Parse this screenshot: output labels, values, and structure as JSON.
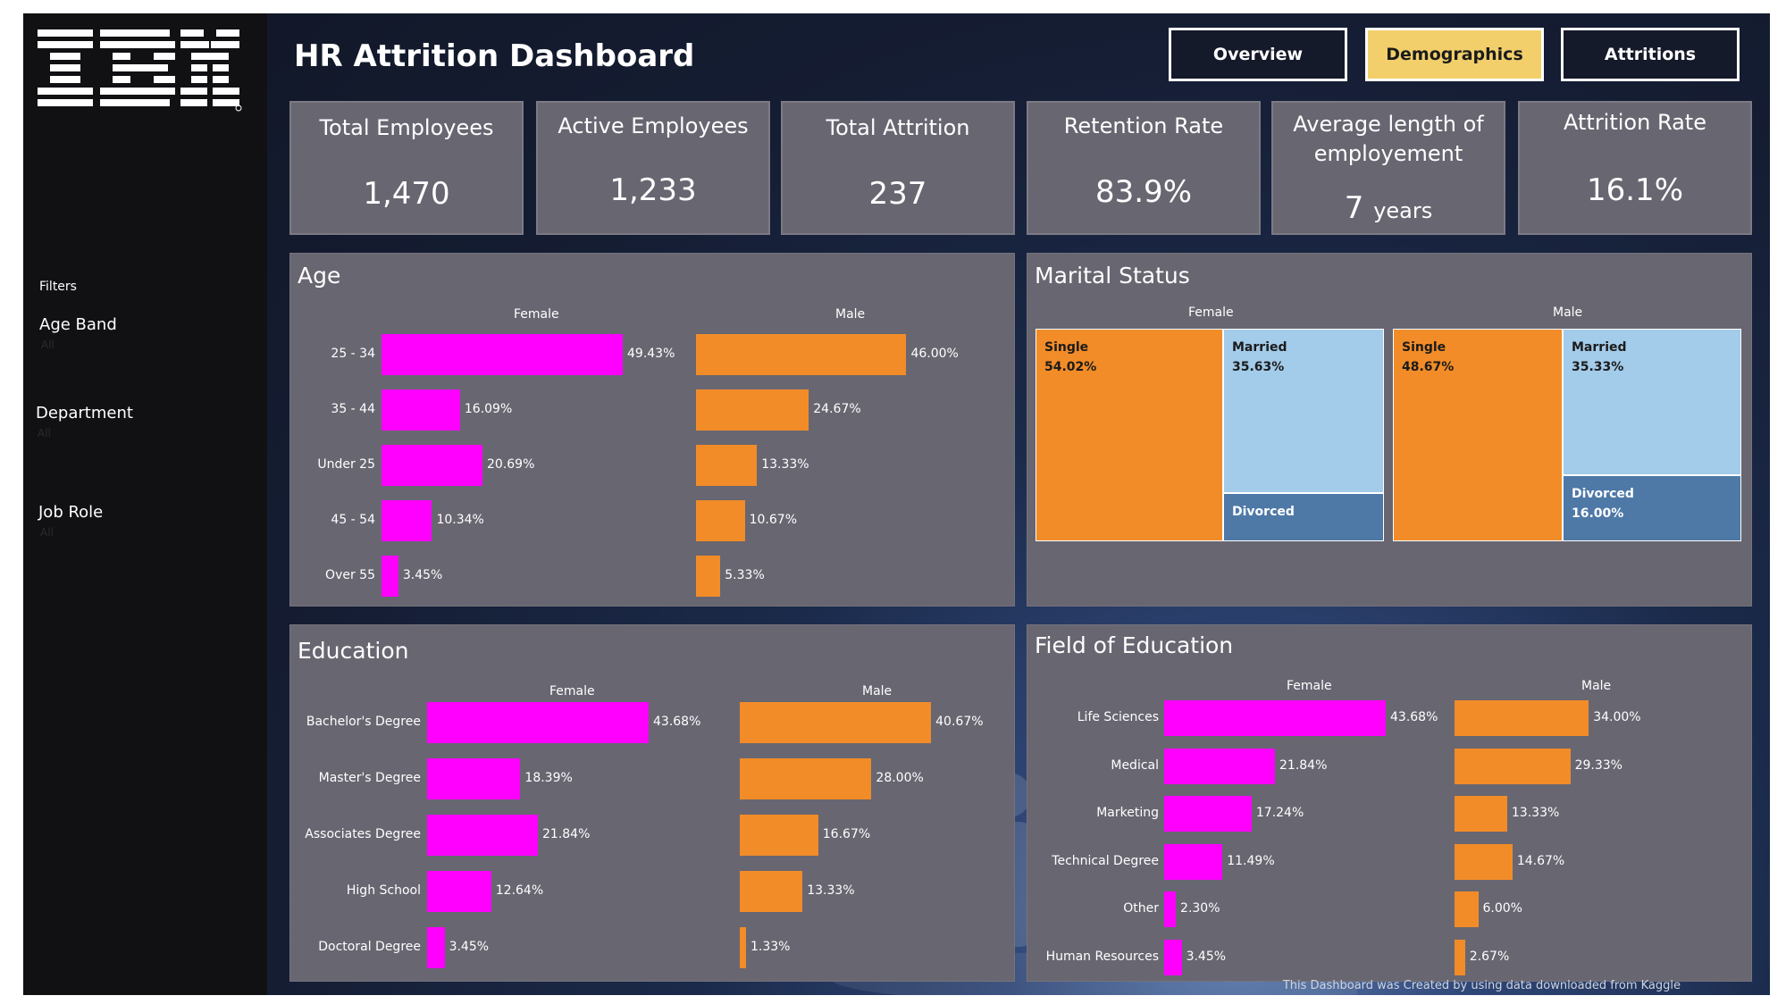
{
  "brand": {
    "logo_text": "IBM",
    "accent_female": "#ff00ff",
    "accent_male": "#f28c28",
    "active_tab": "#f2cf6b"
  },
  "header": {
    "title": "HR Attrition Dashboard"
  },
  "nav": {
    "overview": "Overview",
    "demographics": "Demographics",
    "attritions": "Attritions"
  },
  "filters": {
    "heading": "Filters",
    "age_band": {
      "label": "Age Band",
      "value": "All"
    },
    "department": {
      "label": "Department",
      "value": "All"
    },
    "job_role": {
      "label": "Job Role",
      "value": "All"
    }
  },
  "kpis": {
    "total_employees": {
      "label": "Total Employees",
      "value": "1,470"
    },
    "active_employees": {
      "label": "Active Employees",
      "value": "1,233"
    },
    "total_attrition": {
      "label": "Total Attrition",
      "value": "237"
    },
    "retention_rate": {
      "label": "Retention Rate",
      "value": "83.9%"
    },
    "avg_length": {
      "label_line1": "Average length of",
      "label_line2": "employement",
      "value": "7",
      "unit": "years"
    },
    "attrition_rate": {
      "label": "Attrition Rate",
      "value": "16.1%"
    }
  },
  "common": {
    "female": "Female",
    "male": "Male"
  },
  "panels": {
    "age": {
      "title": "Age"
    },
    "marital": {
      "title": "Marital Status"
    },
    "education": {
      "title": "Education"
    },
    "field": {
      "title": "Field of Education"
    }
  },
  "chart_data": [
    {
      "type": "bar",
      "title": "Age",
      "categories": [
        "25 - 34",
        "35 - 44",
        "Under 25",
        "45 - 54",
        "Over 55"
      ],
      "series": [
        {
          "name": "Female",
          "values": [
            49.43,
            16.09,
            20.69,
            10.34,
            3.45
          ],
          "labels": [
            "49.43%",
            "16.09%",
            "20.69%",
            "10.34%",
            "3.45%"
          ]
        },
        {
          "name": "Male",
          "values": [
            46.0,
            24.67,
            13.33,
            10.67,
            5.33
          ],
          "labels": [
            "46.00%",
            "24.67%",
            "13.33%",
            "10.67%",
            "5.33%"
          ]
        }
      ]
    },
    {
      "type": "treemap",
      "title": "Marital Status",
      "groups": [
        {
          "name": "Female",
          "items": [
            {
              "name": "Single",
              "value": 54.02,
              "label": "54.02%"
            },
            {
              "name": "Married",
              "value": 35.63,
              "label": "35.63%"
            },
            {
              "name": "Divorced",
              "value": 10.35,
              "label": ""
            }
          ]
        },
        {
          "name": "Male",
          "items": [
            {
              "name": "Single",
              "value": 48.67,
              "label": "48.67%"
            },
            {
              "name": "Married",
              "value": 35.33,
              "label": "35.33%"
            },
            {
              "name": "Divorced",
              "value": 16.0,
              "label": "16.00%"
            }
          ]
        }
      ]
    },
    {
      "type": "bar",
      "title": "Education",
      "categories": [
        "Bachelor's Degree",
        "Master's Degree",
        "Associates Degree",
        "High School",
        "Doctoral Degree"
      ],
      "series": [
        {
          "name": "Female",
          "values": [
            43.68,
            18.39,
            21.84,
            12.64,
            3.45
          ],
          "labels": [
            "43.68%",
            "18.39%",
            "21.84%",
            "12.64%",
            "3.45%"
          ]
        },
        {
          "name": "Male",
          "values": [
            40.67,
            28.0,
            16.67,
            13.33,
            1.33
          ],
          "labels": [
            "40.67%",
            "28.00%",
            "16.67%",
            "13.33%",
            "1.33%"
          ]
        }
      ]
    },
    {
      "type": "bar",
      "title": "Field of Education",
      "categories": [
        "Life Sciences",
        "Medical",
        "Marketing",
        "Technical Degree",
        "Other",
        "Human Resources"
      ],
      "series": [
        {
          "name": "Female",
          "values": [
            43.68,
            21.84,
            17.24,
            11.49,
            2.3,
            3.45
          ],
          "labels": [
            "43.68%",
            "21.84%",
            "17.24%",
            "11.49%",
            "2.30%",
            "3.45%"
          ]
        },
        {
          "name": "Male",
          "values": [
            34.0,
            29.33,
            13.33,
            14.67,
            6.0,
            2.67
          ],
          "labels": [
            "34.00%",
            "29.33%",
            "13.33%",
            "14.67%",
            "6.00%",
            "2.67%"
          ]
        }
      ]
    }
  ],
  "footer": {
    "text": "This Dashboard was Created by using data downloaded from Kaggle"
  }
}
